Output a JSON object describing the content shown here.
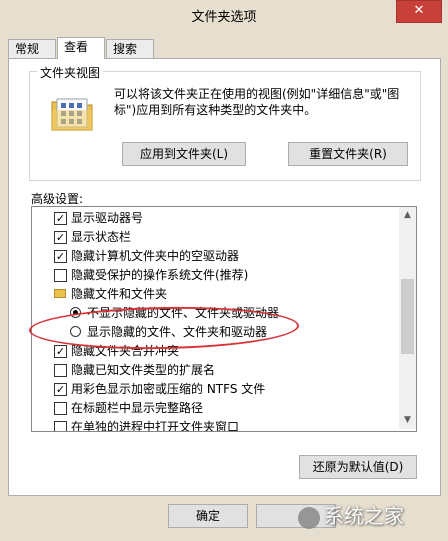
{
  "window": {
    "title": "文件夹选项",
    "close_glyph": "✕"
  },
  "tabs": [
    {
      "label": "常规"
    },
    {
      "label": "查看"
    },
    {
      "label": "搜索"
    }
  ],
  "folder_views": {
    "label": "文件夹视图",
    "description": "可以将该文件夹正在使用的视图(例如\"详细信息\"或\"图标\")应用到所有这种类型的文件夹中。",
    "apply_button": "应用到文件夹(L)",
    "reset_button": "重置文件夹(R)"
  },
  "advanced": {
    "label": "高级设置:",
    "items": [
      {
        "kind": "checkbox",
        "label": "显示驱动器号",
        "checked": true
      },
      {
        "kind": "checkbox",
        "label": "显示状态栏",
        "checked": true
      },
      {
        "kind": "checkbox",
        "label": "隐藏计算机文件夹中的空驱动器",
        "checked": true
      },
      {
        "kind": "checkbox",
        "label": "隐藏受保护的操作系统文件(推荐)",
        "checked": false
      },
      {
        "kind": "folder",
        "label": "隐藏文件和文件夹"
      },
      {
        "kind": "radio",
        "label": "不显示隐藏的文件、文件夹或驱动器",
        "checked": true
      },
      {
        "kind": "radio",
        "label": "显示隐藏的文件、文件夹和驱动器",
        "checked": false
      },
      {
        "kind": "checkbox",
        "label": "隐藏文件夹合并冲突",
        "checked": true
      },
      {
        "kind": "checkbox",
        "label": "隐藏已知文件类型的扩展名",
        "checked": false
      },
      {
        "kind": "checkbox",
        "label": "用彩色显示加密或压缩的 NTFS 文件",
        "checked": true
      },
      {
        "kind": "checkbox",
        "label": "在标题栏中显示完整路径",
        "checked": false
      },
      {
        "kind": "checkbox",
        "label": "在单独的进程中打开文件夹窗口",
        "checked": false
      }
    ],
    "restore_button": "还原为默认值(D)"
  },
  "footer": {
    "ok_button": "确定"
  },
  "watermark": {
    "text": "系统之家"
  },
  "colors": {
    "highlight_ellipse": "#d6363a",
    "close": "#c7413a"
  }
}
